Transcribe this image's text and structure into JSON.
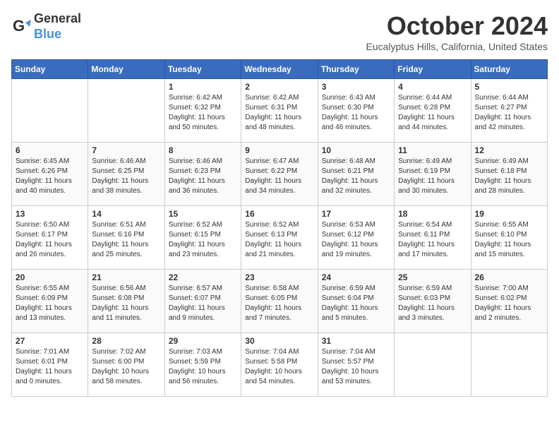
{
  "header": {
    "logo_line1": "General",
    "logo_line2": "Blue",
    "month": "October 2024",
    "location": "Eucalyptus Hills, California, United States"
  },
  "weekdays": [
    "Sunday",
    "Monday",
    "Tuesday",
    "Wednesday",
    "Thursday",
    "Friday",
    "Saturday"
  ],
  "weeks": [
    [
      {
        "day": "",
        "detail": ""
      },
      {
        "day": "",
        "detail": ""
      },
      {
        "day": "1",
        "detail": "Sunrise: 6:42 AM\nSunset: 6:32 PM\nDaylight: 11 hours\nand 50 minutes."
      },
      {
        "day": "2",
        "detail": "Sunrise: 6:42 AM\nSunset: 6:31 PM\nDaylight: 11 hours\nand 48 minutes."
      },
      {
        "day": "3",
        "detail": "Sunrise: 6:43 AM\nSunset: 6:30 PM\nDaylight: 11 hours\nand 46 minutes."
      },
      {
        "day": "4",
        "detail": "Sunrise: 6:44 AM\nSunset: 6:28 PM\nDaylight: 11 hours\nand 44 minutes."
      },
      {
        "day": "5",
        "detail": "Sunrise: 6:44 AM\nSunset: 6:27 PM\nDaylight: 11 hours\nand 42 minutes."
      }
    ],
    [
      {
        "day": "6",
        "detail": "Sunrise: 6:45 AM\nSunset: 6:26 PM\nDaylight: 11 hours\nand 40 minutes."
      },
      {
        "day": "7",
        "detail": "Sunrise: 6:46 AM\nSunset: 6:25 PM\nDaylight: 11 hours\nand 38 minutes."
      },
      {
        "day": "8",
        "detail": "Sunrise: 6:46 AM\nSunset: 6:23 PM\nDaylight: 11 hours\nand 36 minutes."
      },
      {
        "day": "9",
        "detail": "Sunrise: 6:47 AM\nSunset: 6:22 PM\nDaylight: 11 hours\nand 34 minutes."
      },
      {
        "day": "10",
        "detail": "Sunrise: 6:48 AM\nSunset: 6:21 PM\nDaylight: 11 hours\nand 32 minutes."
      },
      {
        "day": "11",
        "detail": "Sunrise: 6:49 AM\nSunset: 6:19 PM\nDaylight: 11 hours\nand 30 minutes."
      },
      {
        "day": "12",
        "detail": "Sunrise: 6:49 AM\nSunset: 6:18 PM\nDaylight: 11 hours\nand 28 minutes."
      }
    ],
    [
      {
        "day": "13",
        "detail": "Sunrise: 6:50 AM\nSunset: 6:17 PM\nDaylight: 11 hours\nand 26 minutes."
      },
      {
        "day": "14",
        "detail": "Sunrise: 6:51 AM\nSunset: 6:16 PM\nDaylight: 11 hours\nand 25 minutes."
      },
      {
        "day": "15",
        "detail": "Sunrise: 6:52 AM\nSunset: 6:15 PM\nDaylight: 11 hours\nand 23 minutes."
      },
      {
        "day": "16",
        "detail": "Sunrise: 6:52 AM\nSunset: 6:13 PM\nDaylight: 11 hours\nand 21 minutes."
      },
      {
        "day": "17",
        "detail": "Sunrise: 6:53 AM\nSunset: 6:12 PM\nDaylight: 11 hours\nand 19 minutes."
      },
      {
        "day": "18",
        "detail": "Sunrise: 6:54 AM\nSunset: 6:11 PM\nDaylight: 11 hours\nand 17 minutes."
      },
      {
        "day": "19",
        "detail": "Sunrise: 6:55 AM\nSunset: 6:10 PM\nDaylight: 11 hours\nand 15 minutes."
      }
    ],
    [
      {
        "day": "20",
        "detail": "Sunrise: 6:55 AM\nSunset: 6:09 PM\nDaylight: 11 hours\nand 13 minutes."
      },
      {
        "day": "21",
        "detail": "Sunrise: 6:56 AM\nSunset: 6:08 PM\nDaylight: 11 hours\nand 11 minutes."
      },
      {
        "day": "22",
        "detail": "Sunrise: 6:57 AM\nSunset: 6:07 PM\nDaylight: 11 hours\nand 9 minutes."
      },
      {
        "day": "23",
        "detail": "Sunrise: 6:58 AM\nSunset: 6:05 PM\nDaylight: 11 hours\nand 7 minutes."
      },
      {
        "day": "24",
        "detail": "Sunrise: 6:59 AM\nSunset: 6:04 PM\nDaylight: 11 hours\nand 5 minutes."
      },
      {
        "day": "25",
        "detail": "Sunrise: 6:59 AM\nSunset: 6:03 PM\nDaylight: 11 hours\nand 3 minutes."
      },
      {
        "day": "26",
        "detail": "Sunrise: 7:00 AM\nSunset: 6:02 PM\nDaylight: 11 hours\nand 2 minutes."
      }
    ],
    [
      {
        "day": "27",
        "detail": "Sunrise: 7:01 AM\nSunset: 6:01 PM\nDaylight: 11 hours\nand 0 minutes."
      },
      {
        "day": "28",
        "detail": "Sunrise: 7:02 AM\nSunset: 6:00 PM\nDaylight: 10 hours\nand 58 minutes."
      },
      {
        "day": "29",
        "detail": "Sunrise: 7:03 AM\nSunset: 5:59 PM\nDaylight: 10 hours\nand 56 minutes."
      },
      {
        "day": "30",
        "detail": "Sunrise: 7:04 AM\nSunset: 5:58 PM\nDaylight: 10 hours\nand 54 minutes."
      },
      {
        "day": "31",
        "detail": "Sunrise: 7:04 AM\nSunset: 5:57 PM\nDaylight: 10 hours\nand 53 minutes."
      },
      {
        "day": "",
        "detail": ""
      },
      {
        "day": "",
        "detail": ""
      }
    ]
  ]
}
